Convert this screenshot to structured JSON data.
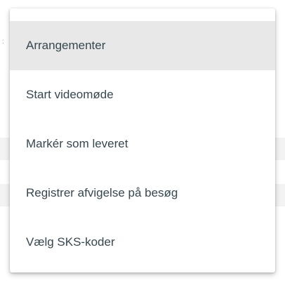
{
  "menu": {
    "items": [
      {
        "label": "Arrangementer",
        "active": true
      },
      {
        "label": "Start videomøde",
        "active": false
      },
      {
        "label": "Markér som leveret",
        "active": false
      },
      {
        "label": "Registrer afvigelse på besøg",
        "active": false
      },
      {
        "label": "Vælg SKS-koder",
        "active": false
      }
    ]
  },
  "colors": {
    "menu_text": "#37474f",
    "active_background": "#e8e8e8",
    "menu_background": "#ffffff"
  }
}
